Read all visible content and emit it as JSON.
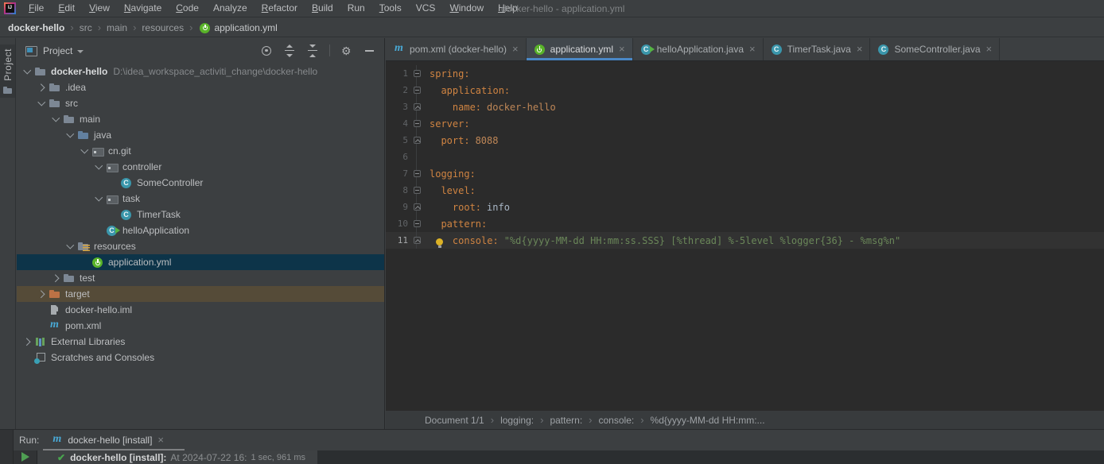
{
  "window": {
    "title": "docker-hello - application.yml"
  },
  "menubar": {
    "items": [
      "File",
      "Edit",
      "View",
      "Navigate",
      "Code",
      "Analyze",
      "Refactor",
      "Build",
      "Run",
      "Tools",
      "VCS",
      "Window",
      "Help"
    ]
  },
  "breadcrumb_bar": {
    "items": [
      "docker-hello",
      "src",
      "main",
      "resources",
      "application.yml"
    ]
  },
  "tool_strip": {
    "project": "Project"
  },
  "project_panel": {
    "title": "Project",
    "tree": [
      {
        "label": "docker-hello",
        "path": "D:\\idea_workspace_activiti_change\\docker-hello"
      },
      {
        "label": ".idea"
      },
      {
        "label": "src"
      },
      {
        "label": "main"
      },
      {
        "label": "java"
      },
      {
        "label": "cn.git"
      },
      {
        "label": "controller"
      },
      {
        "label": "SomeController"
      },
      {
        "label": "task"
      },
      {
        "label": "TimerTask"
      },
      {
        "label": "helloApplication"
      },
      {
        "label": "resources"
      },
      {
        "label": "application.yml"
      },
      {
        "label": "test"
      },
      {
        "label": "target"
      },
      {
        "label": "docker-hello.iml"
      },
      {
        "label": "pom.xml"
      },
      {
        "label": "External Libraries"
      },
      {
        "label": "Scratches and Consoles"
      }
    ]
  },
  "editor": {
    "tabs": [
      {
        "label": "pom.xml (docker-hello)"
      },
      {
        "label": "application.yml"
      },
      {
        "label": "helloApplication.java"
      },
      {
        "label": "TimerTask.java"
      },
      {
        "label": "SomeController.java"
      }
    ],
    "lines": [
      {
        "num": "1",
        "key": "spring:"
      },
      {
        "num": "2",
        "key": "  application:"
      },
      {
        "num": "3",
        "key": "    name:",
        "value": "docker-hello"
      },
      {
        "num": "4",
        "key": "server:"
      },
      {
        "num": "5",
        "key": "  port:",
        "value": "8088"
      },
      {
        "num": "6",
        "key": ""
      },
      {
        "num": "7",
        "key": "logging:"
      },
      {
        "num": "8",
        "key": "  level:"
      },
      {
        "num": "9",
        "key": "    root:",
        "value": "info"
      },
      {
        "num": "10",
        "key": "  pattern:"
      },
      {
        "num": "11",
        "key": "    console:",
        "value": "\"%d{yyyy-MM-dd HH:mm:ss.SSS} [%thread] %-5level %logger{36} - %msg%n\""
      }
    ],
    "breadcrumb": [
      "Document 1/1",
      "logging:",
      "pattern:",
      "console:",
      "%d{yyyy-MM-dd HH:mm:..."
    ]
  },
  "run_panel": {
    "run_label": "Run:",
    "tab_label": "docker-hello [install]",
    "status_name": "docker-hello [install]:",
    "status_time": "At 2024-07-22 16:",
    "status_duration": "1 sec, 961 ms"
  },
  "icons": {
    "spring-boot-icon": "green power circle",
    "maven-icon": "m",
    "class-icon": "C",
    "gear-icon": "⚙",
    "close-icon": "×",
    "success-check-icon": "✔",
    "breadcrumb-separator": "›"
  },
  "colors": {
    "panel_bg": "#3c3f41",
    "editor_bg": "#2b2b2b",
    "accent_tab_underline": "#4a88c7",
    "tree_selection": "#0d3449",
    "excluded_row_highlight": "#554b38",
    "yaml_key": "#d08442",
    "yaml_scalar": "#bf8757",
    "yaml_plain": "#a9b7c6",
    "yaml_string": "#6a8759",
    "spring_green": "#59b329",
    "maven_cyan": "#49a9d6",
    "success_green": "#49a64e"
  }
}
